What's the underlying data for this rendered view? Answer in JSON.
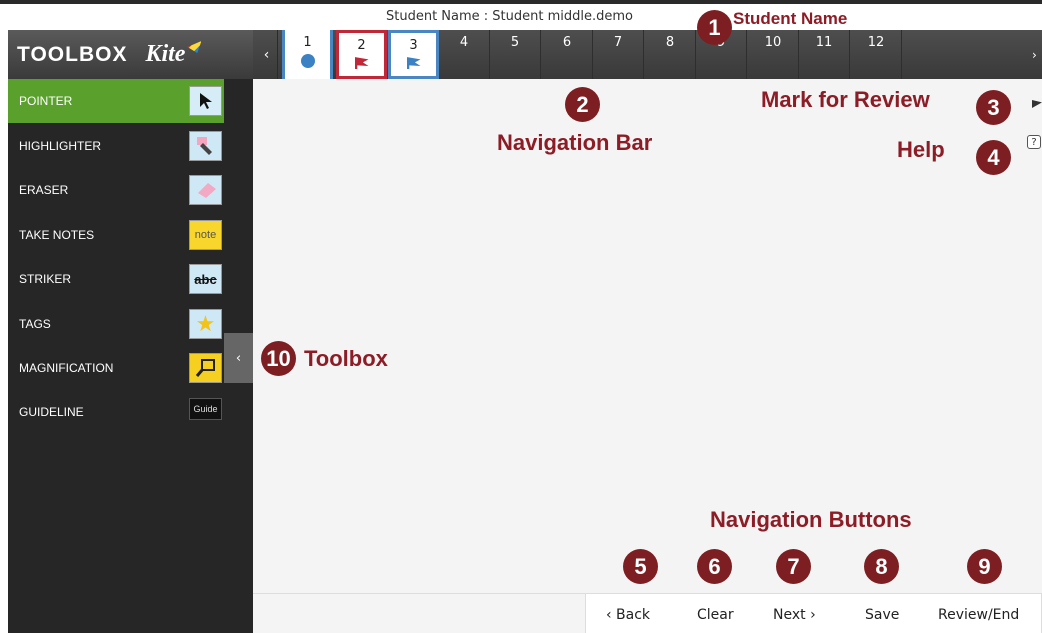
{
  "header": {
    "student_line": "Student Name : Student middle.demo"
  },
  "toolbox": {
    "title": "TOOLBOX",
    "logo": "Kite",
    "tools": [
      {
        "label": "POINTER",
        "icon": "pointer-icon",
        "selected": true
      },
      {
        "label": "HIGHLIGHTER",
        "icon": "highlighter-icon"
      },
      {
        "label": "ERASER",
        "icon": "eraser-icon"
      },
      {
        "label": "TAKE NOTES",
        "icon": "note-icon",
        "icon_text": "note"
      },
      {
        "label": "STRIKER",
        "icon": "striker-icon",
        "icon_text": "abc"
      },
      {
        "label": "TAGS",
        "icon": "star-icon"
      },
      {
        "label": "MAGNIFICATION",
        "icon": "magnifier-icon"
      },
      {
        "label": "GUIDELINE",
        "icon": "guide-icon",
        "icon_text": "Guide"
      }
    ],
    "collapse_glyph": "‹"
  },
  "nav": {
    "prev_glyph": "‹",
    "next_glyph": "›",
    "questions": [
      "1",
      "2",
      "3",
      "4",
      "5",
      "6",
      "7",
      "8",
      "9",
      "10",
      "11",
      "12"
    ]
  },
  "buttons": {
    "back": "‹ Back",
    "clear": "Clear",
    "next": "Next ›",
    "save": "Save",
    "review_end": "Review/End"
  },
  "help_glyph": "?",
  "annotations": {
    "student_name": "Student Name",
    "navigation_bar": "Navigation Bar",
    "mark_for_review": "Mark for Review",
    "help": "Help",
    "toolbox": "Toolbox",
    "navigation_buttons": "Navigation Buttons",
    "numbers": [
      "1",
      "2",
      "3",
      "4",
      "5",
      "6",
      "7",
      "8",
      "9",
      "10"
    ]
  },
  "colors": {
    "accent_green": "#5aa02c",
    "callout_red": "#7d1f22",
    "tab_blue": "#4a87c2",
    "tab_red": "#c0283a"
  }
}
